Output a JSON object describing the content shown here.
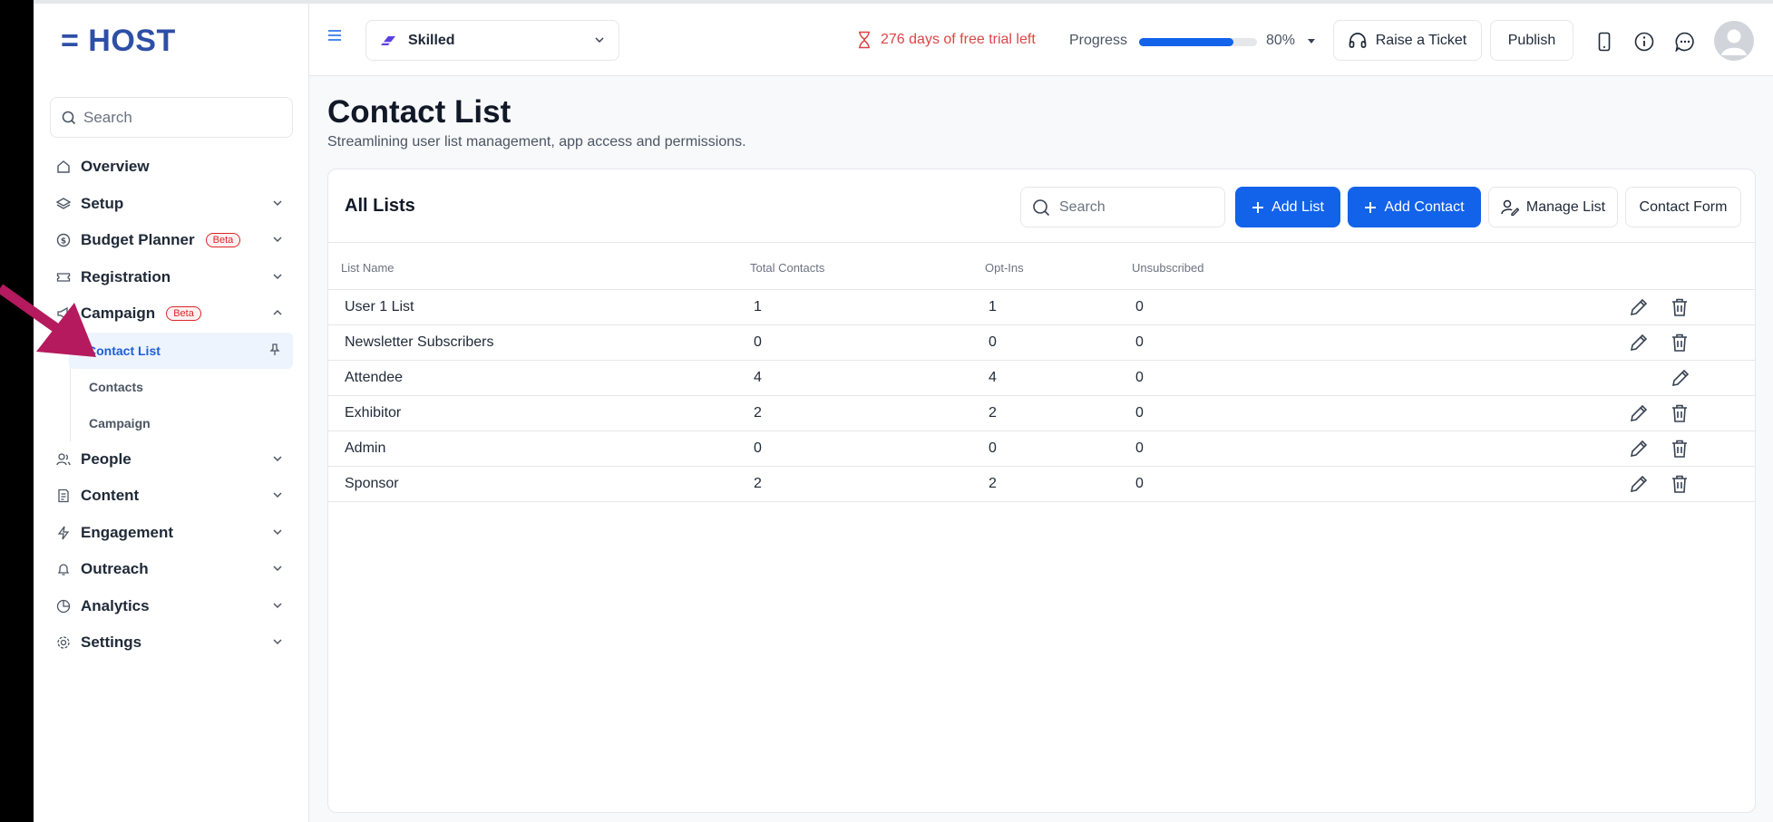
{
  "app": {
    "logo": "= HOST"
  },
  "sidebar": {
    "search_placeholder": "Search",
    "items": [
      {
        "label": "Overview",
        "icon": "home-icon"
      },
      {
        "label": "Setup",
        "icon": "layers-icon"
      },
      {
        "label": "Budget Planner",
        "icon": "dollar-circle-icon",
        "badge": "Beta"
      },
      {
        "label": "Registration",
        "icon": "ticket-icon"
      },
      {
        "label": "Campaign",
        "icon": "megaphone-icon",
        "badge": "Beta",
        "expanded": true,
        "children": [
          "Contact List",
          "Contacts",
          "Campaign"
        ]
      },
      {
        "label": "People",
        "icon": "people-icon"
      },
      {
        "label": "Content",
        "icon": "document-icon"
      },
      {
        "label": "Engagement",
        "icon": "lightning-icon"
      },
      {
        "label": "Outreach",
        "icon": "bell-icon"
      },
      {
        "label": "Analytics",
        "icon": "pie-chart-icon"
      },
      {
        "label": "Settings",
        "icon": "gear-icon"
      }
    ],
    "active_child": "Contact List"
  },
  "topbar": {
    "workspace": "Skilled",
    "trial_text": "276 days of free trial left",
    "progress_label": "Progress",
    "progress_value": 80,
    "progress_text": "80%",
    "raise_ticket": "Raise a Ticket",
    "publish": "Publish"
  },
  "page": {
    "title": "Contact List",
    "subtitle": "Streamlining user list management, app access and permissions."
  },
  "card": {
    "title": "All Lists",
    "search_placeholder": "Search",
    "add_list": "Add List",
    "add_contact": "Add Contact",
    "manage_list": "Manage List",
    "contact_form": "Contact Form"
  },
  "table": {
    "headers": [
      "List Name",
      "Total Contacts",
      "Opt-Ins",
      "Unsubscribed"
    ],
    "rows": [
      {
        "name": "User 1 List",
        "total": "1",
        "optins": "1",
        "unsub": "0",
        "deletable": true
      },
      {
        "name": "Newsletter Subscribers",
        "total": "0",
        "optins": "0",
        "unsub": "0",
        "deletable": true
      },
      {
        "name": "Attendee",
        "total": "4",
        "optins": "4",
        "unsub": "0",
        "deletable": false
      },
      {
        "name": "Exhibitor",
        "total": "2",
        "optins": "2",
        "unsub": "0",
        "deletable": true
      },
      {
        "name": "Admin",
        "total": "0",
        "optins": "0",
        "unsub": "0",
        "deletable": true
      },
      {
        "name": "Sponsor",
        "total": "2",
        "optins": "2",
        "unsub": "0",
        "deletable": true
      }
    ]
  },
  "colors": {
    "primary": "#1262ea",
    "accent_arrow": "#b5195e",
    "warning": "#dc4545"
  }
}
